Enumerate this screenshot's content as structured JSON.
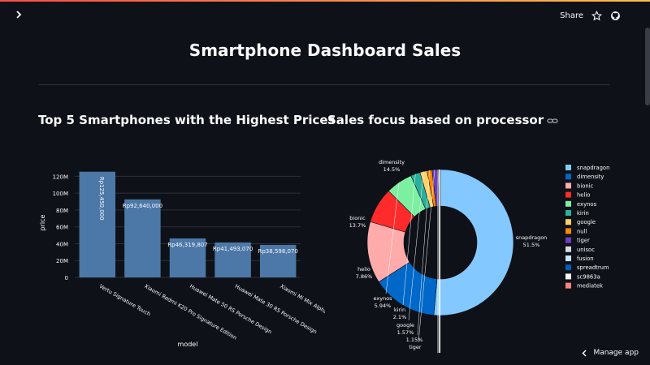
{
  "header": {
    "share_label": "Share"
  },
  "page": {
    "title": "Smartphone Dashboard Sales"
  },
  "sections": {
    "bar_title": "Top 5 Smartphones with the Highest Prices",
    "pie_title": "Sales focus based on processor"
  },
  "footer": {
    "manage_app_label": "Manage app"
  },
  "colors": {
    "background": "#0e1117",
    "bar": "#4c78a8",
    "accent": "#ff4b4b"
  },
  "chart_data": [
    {
      "type": "bar",
      "categories": [
        "Vertu Signature Touch",
        "Xiaomi Redmi K20 Pro Signature Edition",
        "Huawei Mate 50 RS Porsche Design",
        "Huawei Mate 30 RS Porsche Design",
        "Xiaomi Mi Mix Alpha"
      ],
      "values": [
        125450000,
        92640000,
        46319807,
        41493070,
        38598070
      ],
      "data_labels": [
        "Rp125,450,000",
        "Rp92,640,000",
        "Rp46,319,807",
        "Rp41,493,070",
        "Rp38,598,070"
      ],
      "xlabel": "model",
      "ylabel": "price",
      "ylim": [
        0,
        130000000
      ],
      "yticks": [
        0,
        20000000,
        40000000,
        60000000,
        80000000,
        100000000,
        120000000
      ],
      "ytick_labels": [
        "0",
        "20M",
        "40M",
        "60M",
        "80M",
        "100M",
        "120M"
      ],
      "color": "#4c78a8"
    },
    {
      "type": "pie",
      "donut": true,
      "labels": [
        "snapdragon",
        "dimensity",
        "bionic",
        "helio",
        "exynos",
        "kirin",
        "google",
        "null",
        "tiger",
        "unisoc",
        "fusion",
        "spreadtrum",
        "sc9863a",
        "mediatek"
      ],
      "values": [
        51.5,
        14.5,
        13.7,
        7.86,
        5.94,
        2.1,
        1.57,
        1.1,
        1.15,
        0.25,
        0.15,
        0.1,
        0.1,
        0.08
      ],
      "colors": [
        "#83c9ff",
        "#0068c9",
        "#ffabab",
        "#ff2b2b",
        "#7defa1",
        "#29b09d",
        "#ffd16a",
        "#ff8700",
        "#6d3fc0",
        "#d5dae5",
        "#c8e6ff",
        "#005fb8",
        "#ffffff",
        "#ff8080"
      ],
      "slice_labels": [
        {
          "name": "snapdragon",
          "pct": "51.5%"
        },
        {
          "name": "dimensity",
          "pct": "14.5%"
        },
        {
          "name": "bionic",
          "pct": "13.7%"
        },
        {
          "name": "helio",
          "pct": "7.86%"
        },
        {
          "name": "exynos",
          "pct": "5.94%"
        },
        {
          "name": "kirin",
          "pct": "2.1%"
        },
        {
          "name": "google",
          "pct": "1.57%"
        },
        {
          "name": "",
          "pct": "1.15%"
        },
        {
          "name": "tiger",
          "pct": ""
        }
      ],
      "legend_position": "right"
    }
  ]
}
